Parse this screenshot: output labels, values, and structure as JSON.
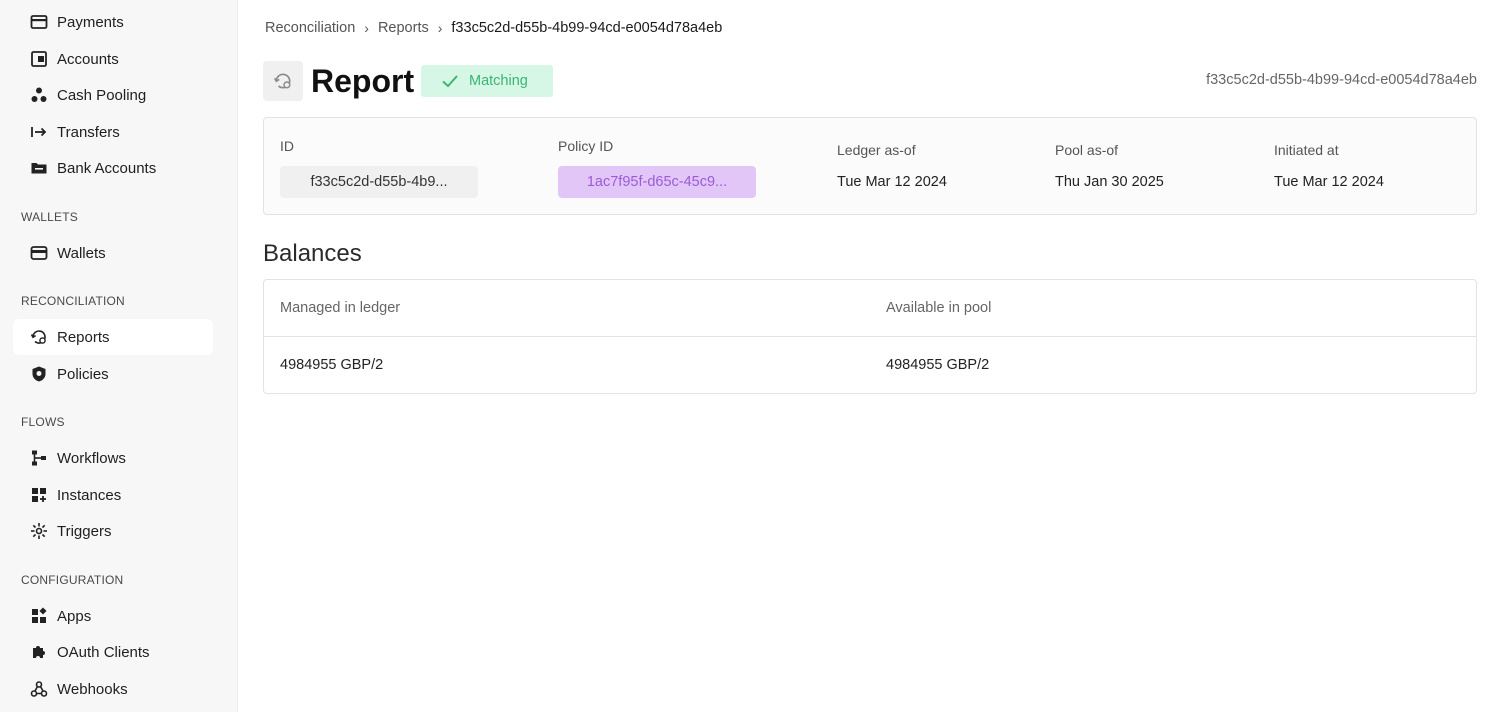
{
  "sidebar": {
    "items_top": [
      {
        "label": "Payments",
        "icon": "payment-icon"
      },
      {
        "label": "Accounts",
        "icon": "wallet-card-icon"
      },
      {
        "label": "Cash Pooling",
        "icon": "pool-icon"
      },
      {
        "label": "Transfers",
        "icon": "transfer-arrow-icon"
      },
      {
        "label": "Bank Accounts",
        "icon": "folder-icon"
      }
    ],
    "sections": {
      "wallets": "WALLETS",
      "reconciliation": "RECONCILIATION",
      "flows": "FLOWS",
      "configuration": "CONFIGURATION"
    },
    "wallets": [
      {
        "label": "Wallets",
        "icon": "wallet-icon"
      }
    ],
    "reconciliation": [
      {
        "label": "Reports",
        "icon": "reports-icon",
        "active": true
      },
      {
        "label": "Policies",
        "icon": "shield-icon"
      }
    ],
    "flows": [
      {
        "label": "Workflows",
        "icon": "workflow-icon"
      },
      {
        "label": "Instances",
        "icon": "instances-icon"
      },
      {
        "label": "Triggers",
        "icon": "trigger-icon"
      }
    ],
    "configuration": [
      {
        "label": "Apps",
        "icon": "apps-icon"
      },
      {
        "label": "OAuth Clients",
        "icon": "puzzle-icon"
      },
      {
        "label": "Webhooks",
        "icon": "webhook-icon"
      }
    ]
  },
  "breadcrumb": {
    "items": [
      "Reconciliation",
      "Reports",
      "f33c5c2d-d55b-4b99-94cd-e0054d78a4eb"
    ],
    "separator": "›"
  },
  "header": {
    "title": "Report",
    "status": "Matching",
    "status_color": "#3bb574",
    "id": "f33c5c2d-d55b-4b99-94cd-e0054d78a4eb"
  },
  "info": {
    "id_label": "ID",
    "id_value": "f33c5c2d-d55b-4b9...",
    "policy_label": "Policy ID",
    "policy_value": "1ac7f95f-d65c-45c9...",
    "ledger_label": "Ledger as-of",
    "ledger_value": "Tue Mar 12 2024",
    "pool_label": "Pool as-of",
    "pool_value": "Thu Jan 30 2025",
    "initiated_label": "Initiated at",
    "initiated_value": "Tue Mar 12 2024"
  },
  "balances": {
    "title": "Balances",
    "columns": [
      "Managed in ledger",
      "Available in pool"
    ],
    "rows": [
      [
        "4984955 GBP/2",
        "4984955 GBP/2"
      ]
    ]
  }
}
